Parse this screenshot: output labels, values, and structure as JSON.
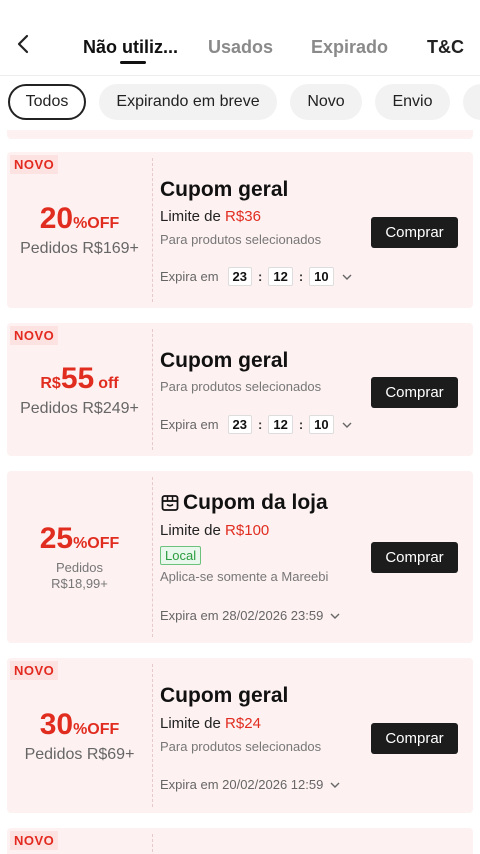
{
  "header": {
    "tabs": [
      {
        "label": "Não utiliz..."
      },
      {
        "label": "Usados"
      },
      {
        "label": "Expirado"
      },
      {
        "label": "T&C"
      }
    ]
  },
  "chips": [
    {
      "label": "Todos"
    },
    {
      "label": "Expirando em breve"
    },
    {
      "label": "Novo"
    },
    {
      "label": "Envio"
    },
    {
      "label": ""
    }
  ],
  "coupons": [
    {
      "badge": "NOVO",
      "discount_big": "20",
      "discount_small": "%OFF",
      "requirement": "Pedidos R$169+",
      "title": "Cupom geral",
      "limit_label": "Limite de ",
      "limit_amount": "R$36",
      "subtitle": "Para produtos selecionados",
      "expiry_label": "Expira em",
      "timer": [
        "23",
        "12",
        "10"
      ],
      "button": "Comprar"
    },
    {
      "badge": "NOVO",
      "currency": "R$",
      "discount_big": "55",
      "discount_small": "off",
      "requirement": "Pedidos R$249+",
      "title": "Cupom geral",
      "subtitle": "Para produtos selecionados",
      "expiry_label": "Expira em",
      "timer": [
        "23",
        "12",
        "10"
      ],
      "button": "Comprar"
    },
    {
      "discount_big": "25",
      "discount_small": "%OFF",
      "requirement_line1": "Pedidos",
      "requirement_line2": "R$18,99+",
      "icon": "store-icon",
      "title": "Cupom da loja",
      "limit_label": "Limite de ",
      "limit_amount": "R$100",
      "tag": "Local",
      "subtitle": "Aplica-se somente a Mareebi",
      "expiry": "Expira em 28/02/2026 23:59",
      "button": "Comprar"
    },
    {
      "badge": "NOVO",
      "discount_big": "30",
      "discount_small": "%OFF",
      "requirement": "Pedidos R$69+",
      "title": "Cupom geral",
      "limit_label": "Limite de ",
      "limit_amount": "R$24",
      "subtitle": "Para produtos selecionados",
      "expiry": "Expira em 20/02/2026 12:59",
      "button": "Comprar"
    },
    {
      "badge": "NOVO"
    }
  ],
  "colors": {
    "accent": "#e12d20",
    "card_bg": "#fdf1f1",
    "button_bg": "#1c1c1c",
    "local_green": "#2a9d3f"
  }
}
